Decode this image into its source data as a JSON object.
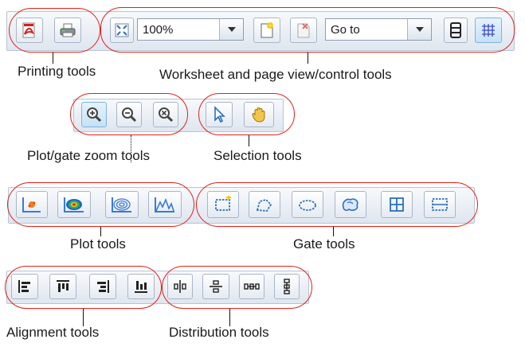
{
  "toolbars": {
    "top": {
      "zoom_combo_value": "100%",
      "goto_combo_value": "Go to",
      "buttons": [
        "pdf-export",
        "print",
        "fit-page",
        "new-worksheet",
        "delete-worksheet",
        "page-layout",
        "grid-layout"
      ]
    },
    "zoom": {
      "buttons": [
        "zoom-in",
        "zoom-out",
        "zoom-reset"
      ]
    },
    "selection": {
      "buttons": [
        "pointer",
        "hand"
      ]
    },
    "plot": {
      "buttons": [
        "dot-plot",
        "density-plot",
        "contour-plot",
        "histogram"
      ]
    },
    "gate": {
      "buttons": [
        "rectangle-gate",
        "polygon-gate",
        "ellipse-gate",
        "freehand-gate",
        "quadrant-gate",
        "interval-gate"
      ]
    },
    "alignment": {
      "buttons": [
        "align-left",
        "align-top",
        "align-right",
        "align-bottom"
      ]
    },
    "distribution": {
      "buttons": [
        "distribute-horizontal-center",
        "distribute-vertical-center",
        "distribute-horizontal",
        "distribute-vertical"
      ]
    }
  },
  "labels": {
    "printing": "Printing tools",
    "worksheet": "Worksheet and page view/control tools",
    "zoom": "Plot/gate zoom tools",
    "selection": "Selection tools",
    "plot": "Plot tools",
    "gate": "Gate tools",
    "alignment": "Alignment tools",
    "distribution": "Distribution tools"
  },
  "colors": {
    "callout_ring": "#e0201b",
    "active_button": "#c5e1f5",
    "toolbar_bg": "#e6ecf3"
  }
}
